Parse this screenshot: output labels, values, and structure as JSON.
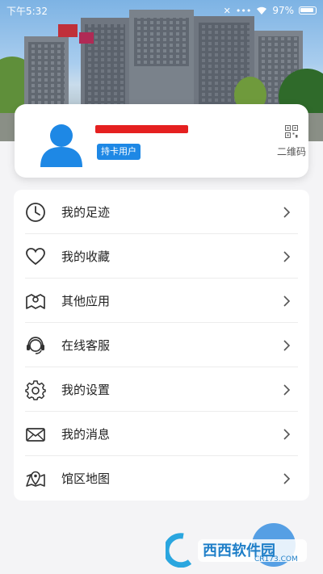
{
  "status_bar": {
    "time": "下午5:32",
    "battery": "97%"
  },
  "profile": {
    "badge": "持卡用户",
    "qr_label": "二维码"
  },
  "menu": {
    "items": [
      {
        "label": "我的足迹",
        "icon": "clock-icon"
      },
      {
        "label": "我的收藏",
        "icon": "heart-icon"
      },
      {
        "label": "其他应用",
        "icon": "map-icon"
      },
      {
        "label": "在线客服",
        "icon": "headset-icon"
      },
      {
        "label": "我的设置",
        "icon": "gear-icon"
      },
      {
        "label": "我的消息",
        "icon": "mail-icon"
      },
      {
        "label": "馆区地图",
        "icon": "map-pin-icon"
      }
    ]
  },
  "watermark": {
    "text": "西西软件园",
    "subtext": "CR173.COM"
  },
  "colors": {
    "accent": "#1e88e5",
    "redaction": "#e52020",
    "background": "#f4f4f6"
  }
}
